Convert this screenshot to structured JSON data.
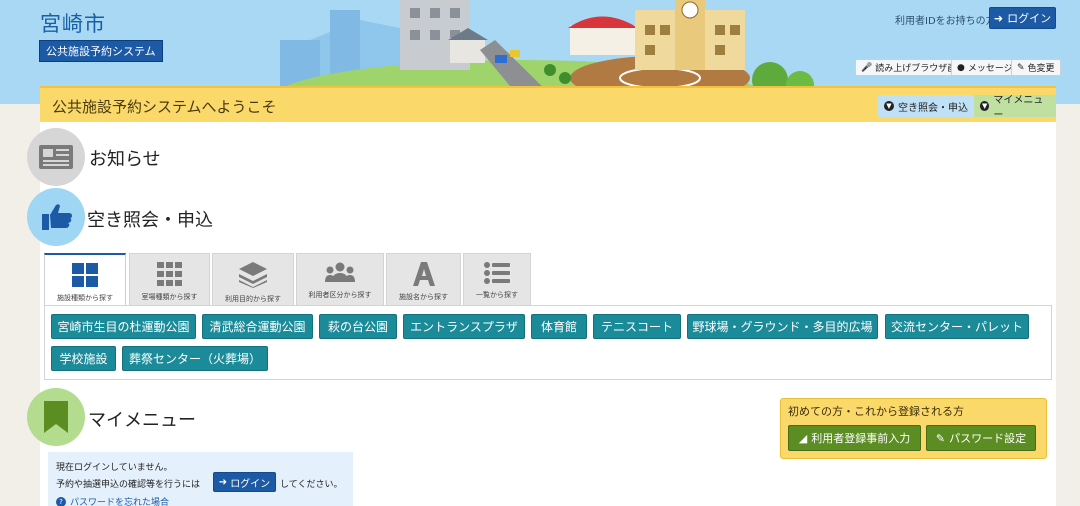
{
  "header": {
    "city_name": "宮崎市",
    "system_badge": "公共施設予約システム",
    "login_hint": "利用者IDをお持ちの方",
    "login_label": "ログイン",
    "util": [
      {
        "label": "読み上げブラウザ画面",
        "icon": "microphone-icon"
      },
      {
        "label": "メッセージ",
        "icon": "speech-bubble-icon"
      },
      {
        "label": "色変更",
        "icon": "brush-icon"
      }
    ]
  },
  "welcome": {
    "text": "公共施設予約システムへようこそ",
    "btn_availability": "空き照会・申込",
    "btn_mymenu": "マイメニュー"
  },
  "sections": {
    "news": "お知らせ",
    "availability": "空き照会・申込",
    "mymenu": "マイメニュー"
  },
  "tabs": [
    {
      "label": "施設種類から探す",
      "icon": "grid-icon"
    },
    {
      "label": "室場種類から探す",
      "icon": "small-grid-icon"
    },
    {
      "label": "利用目的から探す",
      "icon": "layers-icon"
    },
    {
      "label": "利用者区分から探す",
      "icon": "users-icon"
    },
    {
      "label": "施設名から探す",
      "icon": "letter-a-icon"
    },
    {
      "label": "一覧から探す",
      "icon": "list-icon"
    }
  ],
  "facilities": [
    "宮崎市生目の杜運動公園",
    "清武総合運動公園",
    "萩の台公園",
    "エントランスプラザ",
    "体育館",
    "テニスコート",
    "野球場・グラウンド・多目的広場",
    "交流センター・パレット",
    "学校施設",
    "葬祭センター（火葬場）"
  ],
  "first_time": {
    "title": "初めての方・これから登録される方",
    "register": "利用者登録事前入力",
    "password": "パスワード設定"
  },
  "login_info": {
    "line1": "現在ログインしていません。",
    "line2_a": "予約や抽選申込の確認等を行うには",
    "login": "ログイン",
    "line2_b": "してください。",
    "forgot": "パスワードを忘れた場合"
  },
  "colors": {
    "brand_blue": "#1d5aa5",
    "teal": "#1b8b9a",
    "yellow": "#fbd86a",
    "green": "#5c8d22",
    "sky": "#a8d8f4"
  }
}
